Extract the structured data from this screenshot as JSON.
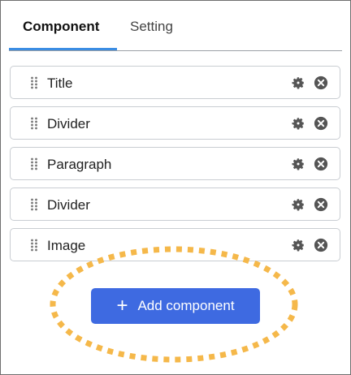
{
  "tabs": [
    {
      "label": "Component",
      "active": true
    },
    {
      "label": "Setting",
      "active": false
    }
  ],
  "components": [
    {
      "label": "Title"
    },
    {
      "label": "Divider"
    },
    {
      "label": "Paragraph"
    },
    {
      "label": "Divider"
    },
    {
      "label": "Image"
    }
  ],
  "add_button": {
    "label": "Add component",
    "icon": "plus-icon"
  },
  "colors": {
    "accent": "#3b8de3",
    "button": "#3e6ae1",
    "highlight": "#f5b84a",
    "icon": "#555555"
  }
}
